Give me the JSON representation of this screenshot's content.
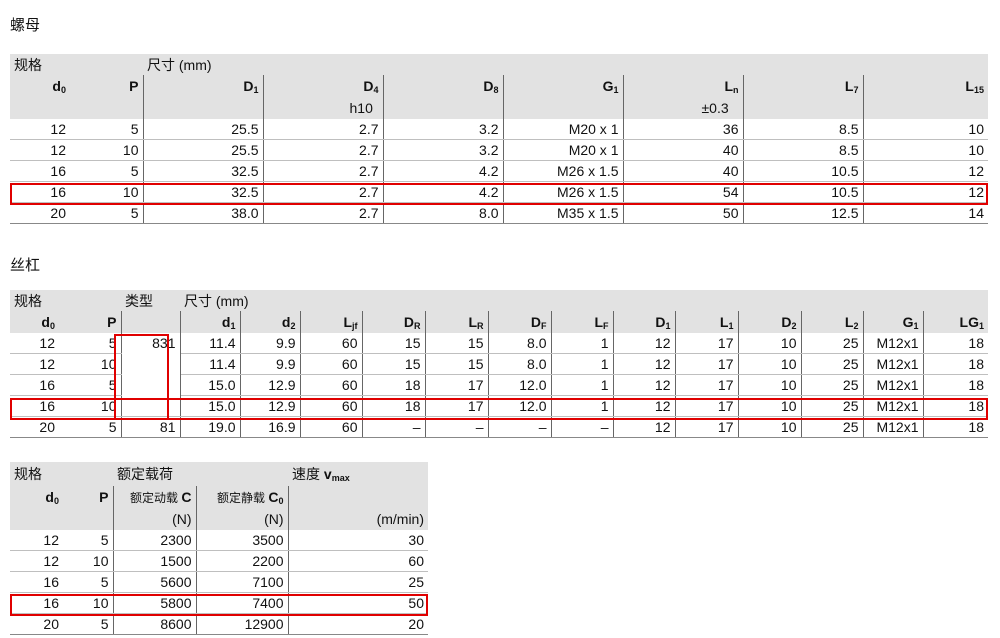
{
  "nut": {
    "title": "螺母",
    "group_spec": "规格",
    "group_dims": "尺寸 (mm)",
    "headers": [
      {
        "main": "d",
        "sub": "0"
      },
      {
        "main": "P",
        "sub": ""
      },
      {
        "main": "D",
        "sub": "1"
      },
      {
        "main": "D",
        "sub": "4"
      },
      {
        "main": "D",
        "sub": "8"
      },
      {
        "main": "G",
        "sub": "1"
      },
      {
        "main": "L",
        "sub": "n"
      },
      {
        "main": "L",
        "sub": "7"
      },
      {
        "main": "L",
        "sub": "15"
      }
    ],
    "subheaders": [
      "",
      "",
      "",
      "h10",
      "",
      "",
      "±0.3",
      "",
      ""
    ],
    "rows": [
      [
        "12",
        "5",
        "25.5",
        "2.7",
        "3.2",
        "M20 x 1",
        "36",
        "8.5",
        "10"
      ],
      [
        "12",
        "10",
        "25.5",
        "2.7",
        "3.2",
        "M20 x 1",
        "40",
        "8.5",
        "10"
      ],
      [
        "16",
        "5",
        "32.5",
        "2.7",
        "4.2",
        "M26 x 1.5",
        "40",
        "10.5",
        "12"
      ],
      [
        "16",
        "10",
        "32.5",
        "2.7",
        "4.2",
        "M26 x 1.5",
        "54",
        "10.5",
        "12"
      ],
      [
        "20",
        "5",
        "38.0",
        "2.7",
        "8.0",
        "M35 x 1.5",
        "50",
        "12.5",
        "14"
      ]
    ]
  },
  "screw": {
    "title": "丝杠",
    "group_spec": "规格",
    "group_type": "类型",
    "group_dims": "尺寸 (mm)",
    "headers": [
      {
        "main": "d",
        "sub": "0"
      },
      {
        "main": "P",
        "sub": ""
      },
      {
        "main": "d",
        "sub": "1"
      },
      {
        "main": "d",
        "sub": "2"
      },
      {
        "main": "L",
        "sub": "jf"
      },
      {
        "main": "D",
        "sub": "R"
      },
      {
        "main": "L",
        "sub": "R"
      },
      {
        "main": "D",
        "sub": "F"
      },
      {
        "main": "L",
        "sub": "F"
      },
      {
        "main": "D",
        "sub": "1"
      },
      {
        "main": "L",
        "sub": "1"
      },
      {
        "main": "D",
        "sub": "2"
      },
      {
        "main": "L",
        "sub": "2"
      },
      {
        "main": "G",
        "sub": "1"
      },
      {
        "main": "LG",
        "sub": "1"
      }
    ],
    "type_values": [
      "831",
      "81"
    ],
    "rows": [
      [
        "12",
        "5",
        "11.4",
        "9.9",
        "60",
        "15",
        "15",
        "8.0",
        "1",
        "12",
        "17",
        "10",
        "25",
        "M12x1",
        "18"
      ],
      [
        "12",
        "10",
        "11.4",
        "9.9",
        "60",
        "15",
        "15",
        "8.0",
        "1",
        "12",
        "17",
        "10",
        "25",
        "M12x1",
        "18"
      ],
      [
        "16",
        "5",
        "15.0",
        "12.9",
        "60",
        "18",
        "17",
        "12.0",
        "1",
        "12",
        "17",
        "10",
        "25",
        "M12x1",
        "18"
      ],
      [
        "16",
        "10",
        "15.0",
        "12.9",
        "60",
        "18",
        "17",
        "12.0",
        "1",
        "12",
        "17",
        "10",
        "25",
        "M12x1",
        "18"
      ],
      [
        "20",
        "5",
        "19.0",
        "16.9",
        "60",
        "–",
        "–",
        "–",
        "–",
        "12",
        "17",
        "10",
        "25",
        "M12x1",
        "18"
      ]
    ]
  },
  "load": {
    "group_spec": "规格",
    "group_load": "额定载荷",
    "group_speed": "速度 ",
    "speed_main": "v",
    "speed_sub": "max",
    "headers": [
      {
        "main": "d",
        "sub": "0"
      },
      {
        "main": "P",
        "sub": ""
      },
      {
        "pre": "额定动载 ",
        "main": "C",
        "sub": ""
      },
      {
        "pre": "额定静载 ",
        "main": "C",
        "sub": "0"
      }
    ],
    "units": [
      "",
      "",
      "(N)",
      "(N)",
      "(m/min)"
    ],
    "rows": [
      [
        "12",
        "5",
        "2300",
        "3500",
        "30"
      ],
      [
        "12",
        "10",
        "1500",
        "2200",
        "60"
      ],
      [
        "16",
        "5",
        "5600",
        "7100",
        "25"
      ],
      [
        "16",
        "10",
        "5800",
        "7400",
        "50"
      ],
      [
        "20",
        "5",
        "8600",
        "12900",
        "20"
      ]
    ]
  }
}
